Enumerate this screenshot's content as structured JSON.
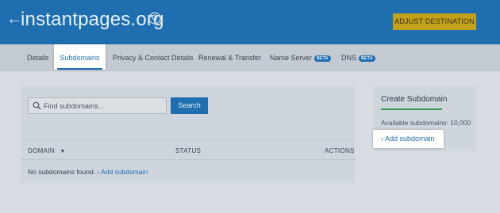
{
  "header": {
    "title": "instantpages.org",
    "adjust_label": "ADJUST DESTINATION",
    "back_icon": "back-arrow-icon",
    "pin_icon": "location-pin-icon"
  },
  "tabs": [
    {
      "label": "Details"
    },
    {
      "label": "Subdomains",
      "active": true
    },
    {
      "label": "Privacy & Contact Details"
    },
    {
      "label": "Renewal & Transfer"
    },
    {
      "label": "Name Server",
      "badge": "BETA"
    },
    {
      "label": "DNS",
      "badge": "BETA"
    }
  ],
  "search": {
    "placeholder": "Find subdomains...",
    "button_label": "Search"
  },
  "table": {
    "columns": [
      "DOMAIN",
      "STATUS",
      "ACTIONS"
    ],
    "sort_indicator": "▼",
    "empty_text": "No subdomains found.",
    "empty_link": "› Add subdomain"
  },
  "card": {
    "title": "Create Subdomain",
    "available": "Available subdomains: 10,000",
    "add_label": "› Add subdomain"
  },
  "colors": {
    "brand_blue": "#1f6fb0",
    "accent_gold": "#c3a11a",
    "progress_green": "#3a9b4c"
  }
}
